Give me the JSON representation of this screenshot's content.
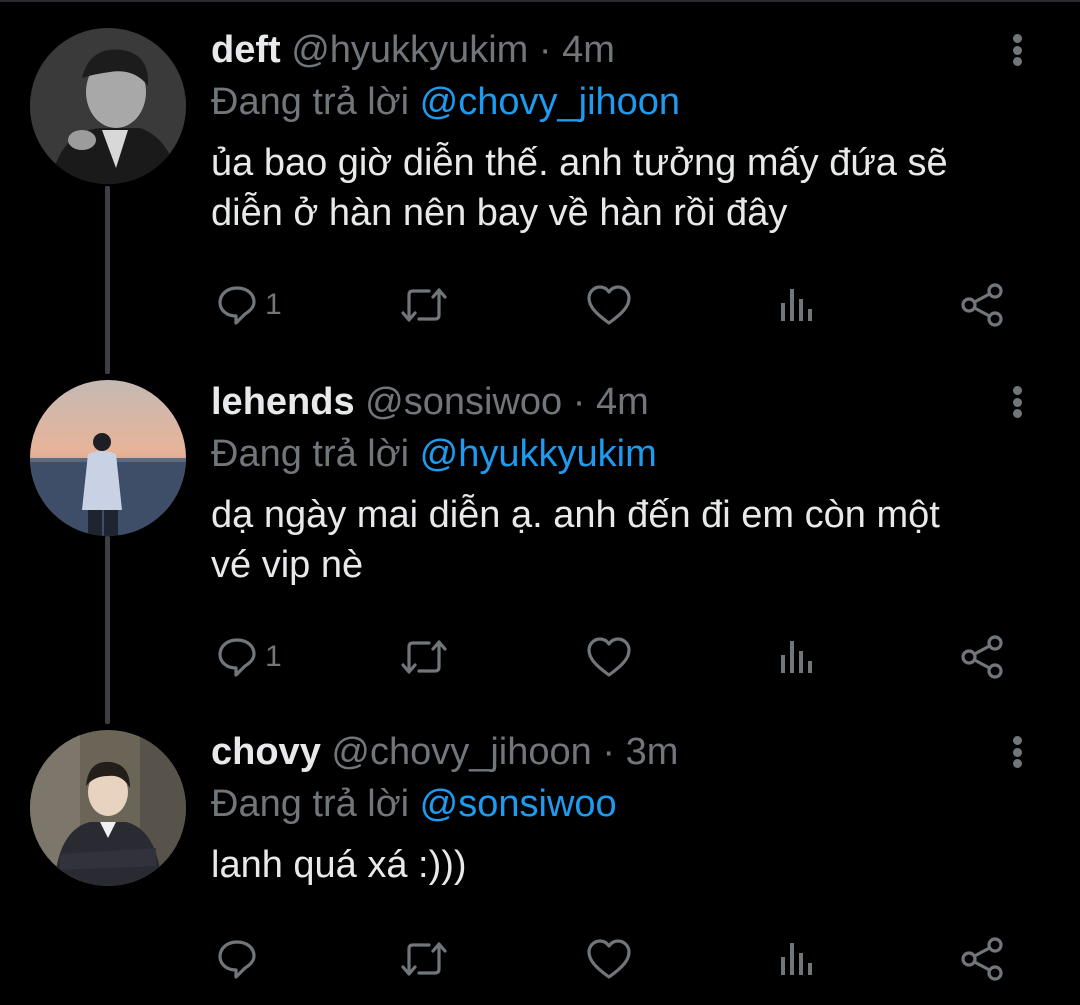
{
  "tweets": [
    {
      "display_name": "deft",
      "handle": "@hyukkyukim",
      "separator": "·",
      "time": "4m",
      "reply_prefix": "Đang trả lời",
      "reply_to": "@chovy_jihoon",
      "text_lines": [
        "ủa bao giờ diễn thế. anh tưởng mấy đứa sẽ",
        "diễn ở hàn nên bay về hàn rồi đây"
      ],
      "reply_count": "1",
      "avatar_icon": "avatar-deft"
    },
    {
      "display_name": "lehends",
      "handle": "@sonsiwoo",
      "separator": "·",
      "time": "4m",
      "reply_prefix": "Đang trả lời",
      "reply_to": "@hyukkyukim",
      "text_lines": [
        "dạ ngày mai diễn ạ. anh đến đi em còn một",
        "vé vip nè"
      ],
      "reply_count": "1",
      "avatar_icon": "avatar-lehends"
    },
    {
      "display_name": "chovy",
      "handle": "@chovy_jihoon",
      "separator": "·",
      "time": "3m",
      "reply_prefix": "Đang trả lời",
      "reply_to": "@sonsiwoo",
      "text_lines": [
        "lanh quá xá :)))"
      ],
      "reply_count": "",
      "avatar_icon": "avatar-chovy"
    }
  ],
  "icons": {
    "reply": "reply-bubble-icon",
    "retweet": "retweet-icon",
    "like": "heart-icon",
    "views": "bar-chart-icon",
    "share": "share-icon",
    "more": "more-vertical-icon"
  },
  "colors": {
    "background": "#000000",
    "text": "#e7e9ea",
    "muted": "#71767b",
    "link": "#1d9bf0",
    "thread_line": "#3c4045"
  }
}
